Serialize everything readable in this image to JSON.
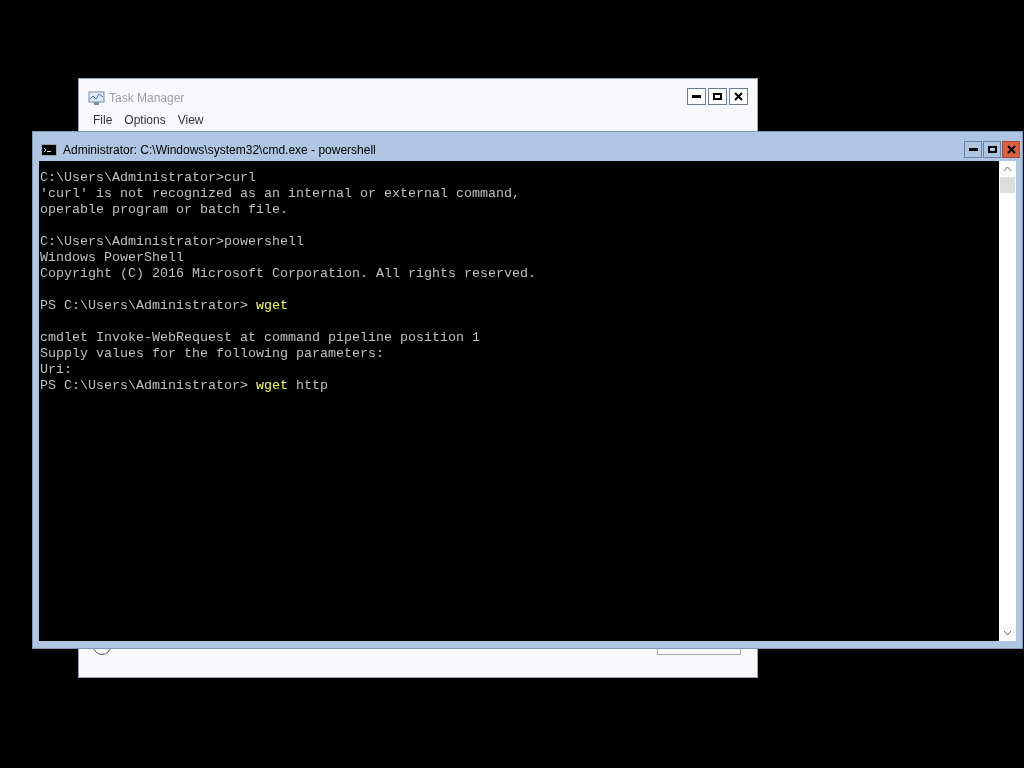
{
  "task_manager": {
    "title": "Task Manager",
    "menu": [
      "File",
      "Options",
      "View"
    ]
  },
  "console": {
    "title": "Administrator: C:\\Windows\\system32\\cmd.exe - powershell",
    "blocks": [
      [
        [
          {
            "kind": "output",
            "text": "C:\\Users\\Administrator>curl"
          }
        ],
        [
          {
            "kind": "output",
            "text": "'curl' is not recognized as an internal or external command,"
          }
        ],
        [
          {
            "kind": "output",
            "text": "operable program or batch file."
          }
        ]
      ],
      [
        [
          {
            "kind": "output",
            "text": "C:\\Users\\Administrator>powershell"
          }
        ],
        [
          {
            "kind": "output",
            "text": "Windows PowerShell"
          }
        ],
        [
          {
            "kind": "output",
            "text": "Copyright (C) 2016 Microsoft Corporation. All rights reserved."
          }
        ]
      ],
      [
        [
          {
            "kind": "output",
            "text": "PS C:\\Users\\Administrator> "
          },
          {
            "kind": "command",
            "text": "wget"
          }
        ]
      ],
      [
        [
          {
            "kind": "output",
            "text": "cmdlet Invoke-WebRequest at command pipeline position 1"
          }
        ],
        [
          {
            "kind": "output",
            "text": "Supply values for the following parameters:"
          }
        ],
        [
          {
            "kind": "output",
            "text": "Uri:"
          }
        ],
        [
          {
            "kind": "output",
            "text": "PS C:\\Users\\Administrator> "
          },
          {
            "kind": "command",
            "text": "wget"
          },
          {
            "kind": "output",
            "text": " http"
          }
        ]
      ]
    ]
  }
}
